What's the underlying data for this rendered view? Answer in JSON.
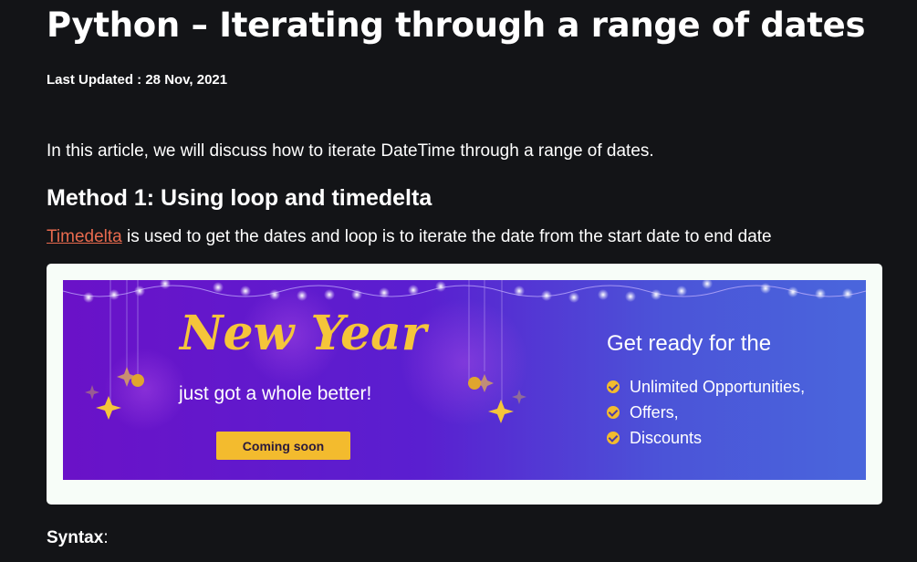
{
  "article": {
    "title": "Python – Iterating through a range of dates",
    "last_updated": "Last Updated : 28 Nov, 2021",
    "intro": "In this article, we will discuss how to iterate DateTime through a range of dates.",
    "method_heading": "Method 1: Using loop and timedelta",
    "paragraph_link": "Timedelta",
    "paragraph_rest": " is used to get the dates and loop is to iterate the date from the start date to end date",
    "syntax_label": "Syntax",
    "syntax_colon": ":"
  },
  "ad": {
    "headline": "New Year",
    "subline": "just got a whole better!",
    "button_label": "Coming soon",
    "promo_heading": "Get ready for the",
    "promo_items": [
      "Unlimited Opportunities,",
      "Offers,",
      "Discounts"
    ],
    "colors": {
      "gold": "#f3bb2e",
      "purple": "#6a12c8",
      "blue": "#4a66dc"
    }
  },
  "colors": {
    "background": "#131417",
    "link": "#e86a4e",
    "ad_frame": "#f7fdf8"
  }
}
